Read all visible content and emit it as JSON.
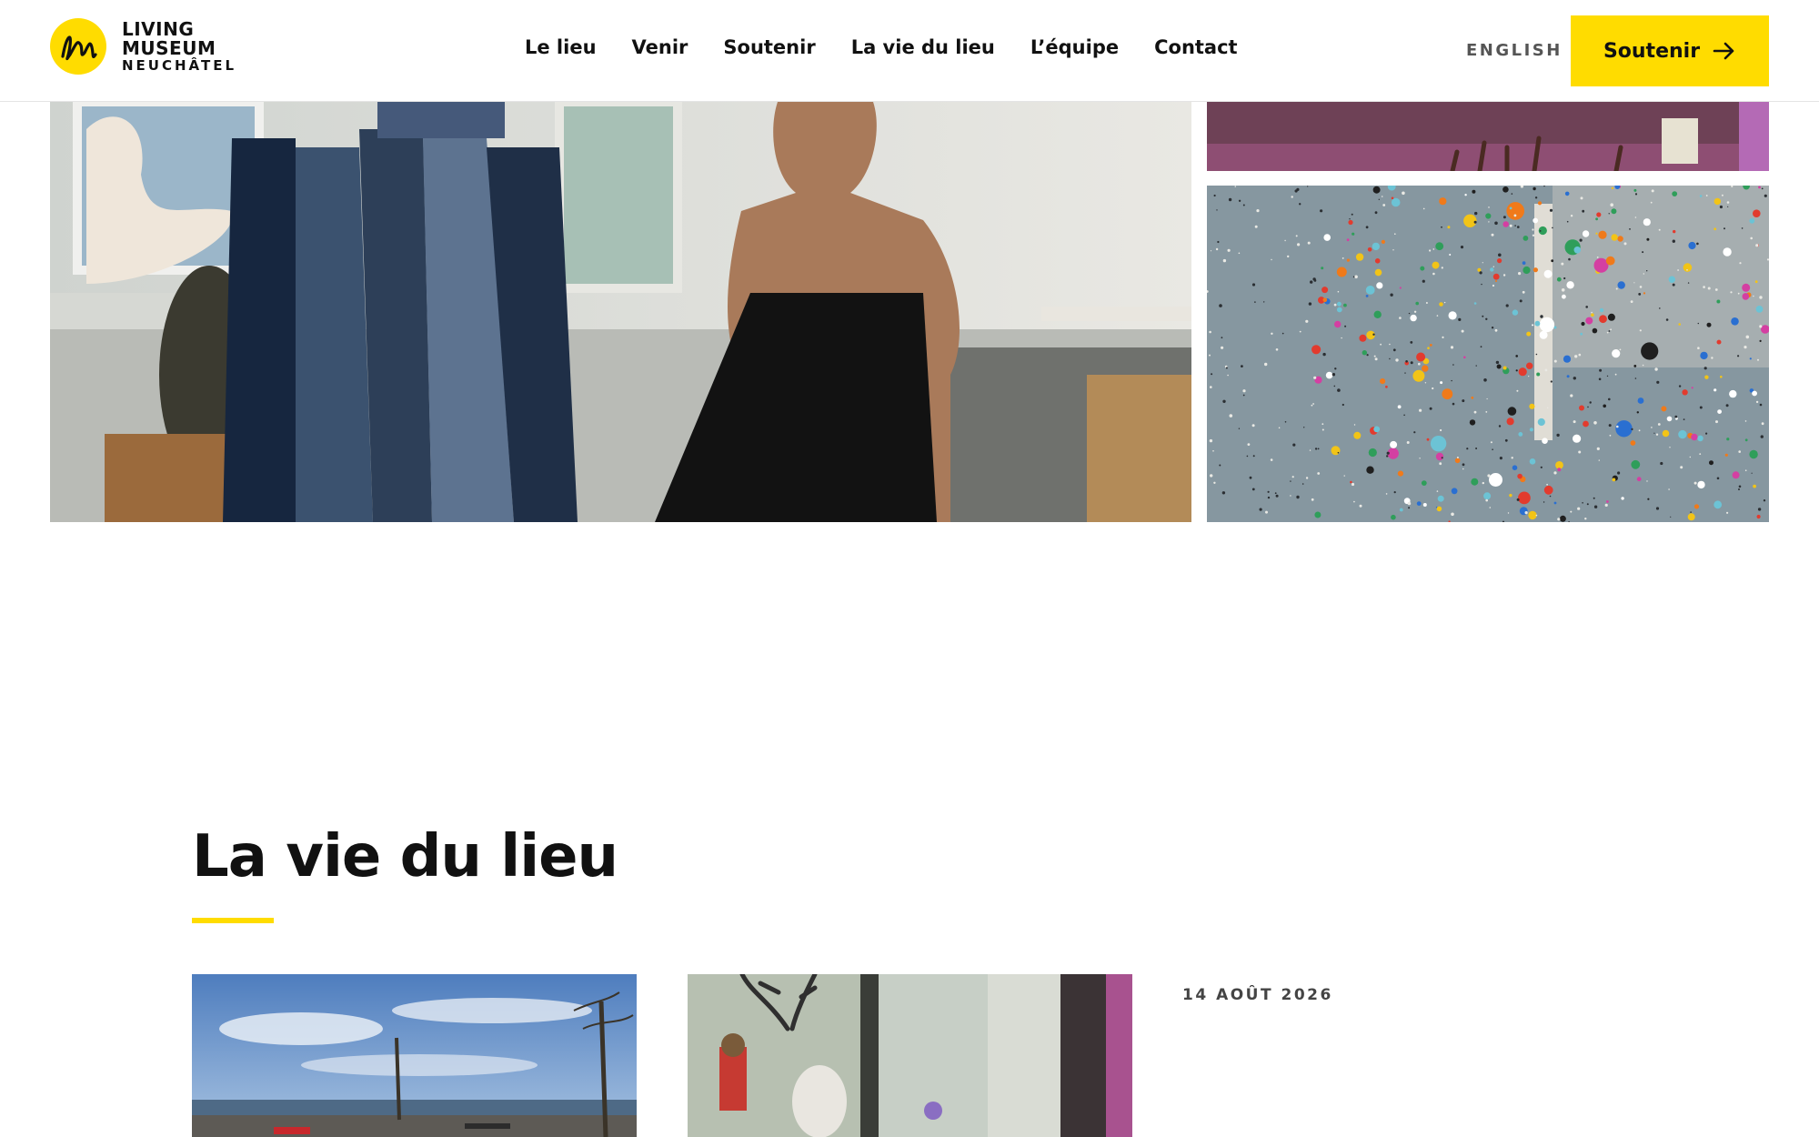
{
  "header": {
    "logo": {
      "line1": "LIVING",
      "line2": "MUSEUM",
      "line3": "NEUCHÂTEL",
      "mark_color": "#ffdc00"
    },
    "nav": [
      "Le lieu",
      "Venir",
      "Soutenir",
      "La vie du lieu",
      "L’équipe",
      "Contact"
    ],
    "language_link": "ENGLISH",
    "cta_label": "Soutenir",
    "cta_icon": "arrow-right-icon",
    "accent_color": "#ffdc00"
  },
  "gallery": {
    "images": [
      "studio-sculpture-apron-photo",
      "painted-floor-brushes-photo",
      "paint-splattered-floor-photo"
    ]
  },
  "section": {
    "title": "La vie du lieu",
    "posts": [
      {
        "image": "lakeside-promenade-photo",
        "date": ""
      },
      {
        "image": "deer-sculpture-window-photo",
        "date": ""
      },
      {
        "image": "",
        "date": "14 AOÛT 2026"
      }
    ]
  }
}
